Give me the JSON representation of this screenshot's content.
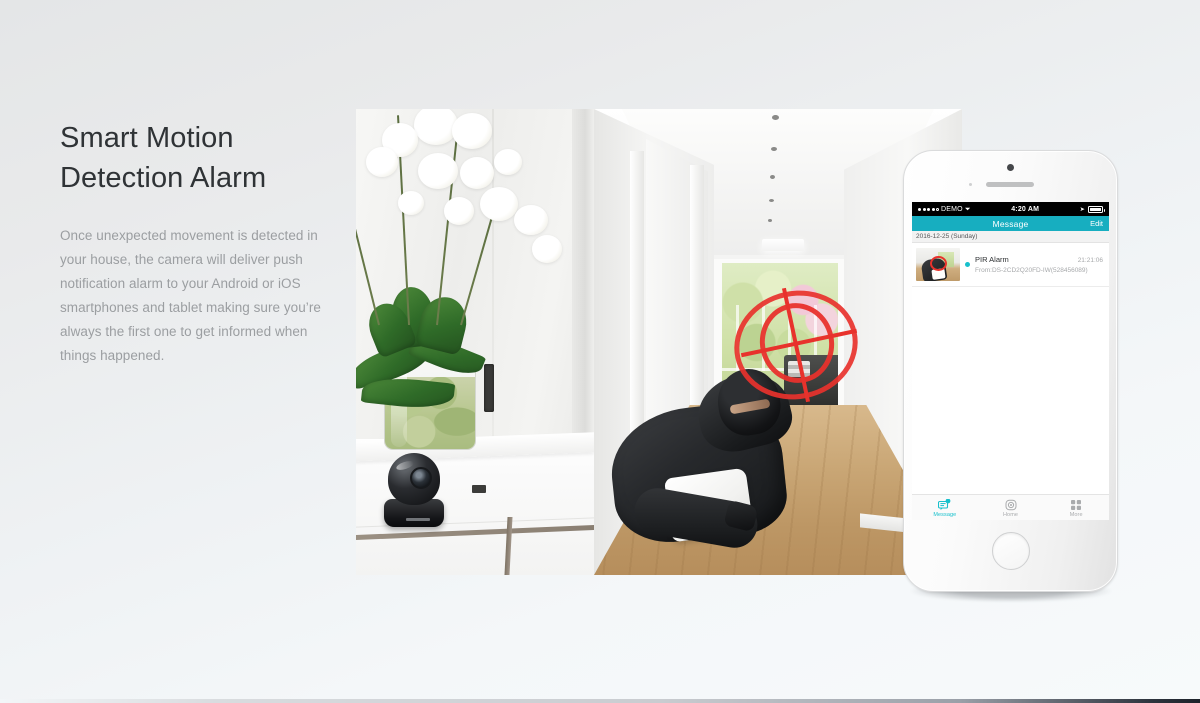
{
  "page": {
    "headline": "Smart Motion\nDetection Alarm",
    "body": "Once unexpected movement is detected in your house, the camera will deliver push notification alarm to your Android or iOS smartphones and tablet making sure you’re always the first one to get informed when things happened."
  },
  "colors": {
    "accent_teal": "#17aec0",
    "unread_dot": "#17c0cc",
    "crosshair_red": "#e8322c",
    "headline_text": "#2f3336",
    "body_text": "#9b9ea1",
    "background_top": "#e4e6e7",
    "background_bottom": "#f7fafb"
  },
  "photos": {
    "left": {
      "caption": "White orchid in a glass pot on a white console table with a black dome security camera"
    },
    "right": {
      "caption": "Hooded intruder in a balaclava carrying a white object in a bright hallway with a red targeting crosshair over his head"
    }
  },
  "phone": {
    "status_bar": {
      "carrier": "DEMO",
      "signal_icon": "signal-dots-icon",
      "wifi_icon": "wifi-icon",
      "time": "4:20 AM",
      "location_icon": "location-arrow-icon",
      "battery_icon": "battery-icon"
    },
    "nav": {
      "title": "Message",
      "edit_label": "Edit"
    },
    "date_header": "2016-12-25 (Sunday)",
    "messages": [
      {
        "title": "PIR Alarm",
        "time": "21:21:06",
        "from": "From:DS-2CD2Q20FD-IW(528456089)",
        "unread": true,
        "thumbnail": "intruder-snapshot"
      }
    ],
    "tabs": [
      {
        "label": "Message",
        "icon": "message-bubble-icon",
        "active": true
      },
      {
        "label": "Home",
        "icon": "home-camera-icon",
        "active": false
      },
      {
        "label": "More",
        "icon": "grid-more-icon",
        "active": false
      }
    ],
    "hardware": {
      "earpiece": "earpiece-speaker",
      "front_camera": "front-camera-icon",
      "home_button": "home-button"
    }
  }
}
